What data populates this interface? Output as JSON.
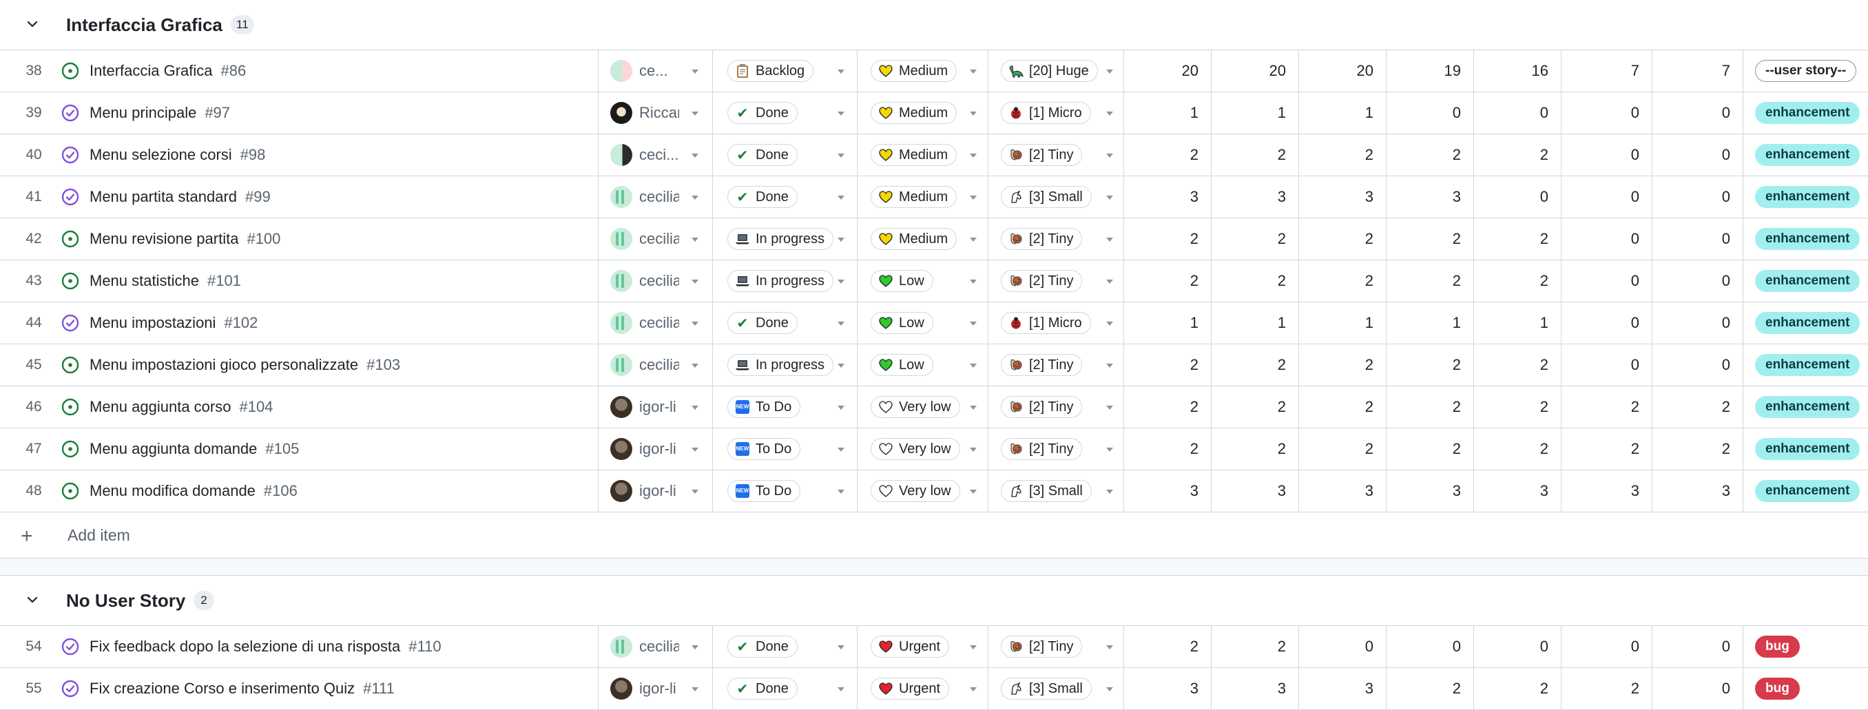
{
  "groups": [
    {
      "title": "Interfaccia Grafica",
      "count": "11",
      "rows": [
        {
          "num": "38",
          "state": "open",
          "title": "Interfaccia Grafica",
          "issue": "#86",
          "avatar": "red",
          "assignee": "ce...",
          "status": {
            "icon": "clipboard-icon",
            "glyph": "📋",
            "label": "Backlog"
          },
          "priority": {
            "icon": "yellow-heart-icon",
            "color": "#f5d800",
            "label": "Medium"
          },
          "size": {
            "icon": "dinosaur-icon",
            "glyph": "🦕",
            "label": "[20] Huge"
          },
          "values": [
            "20",
            "20",
            "20",
            "19",
            "16",
            "7",
            "7"
          ],
          "label": {
            "text": "--user story--",
            "bg": "#ffffff",
            "fg": "#1f2328",
            "border": "#8c959f"
          }
        },
        {
          "num": "39",
          "state": "closed",
          "title": "Menu principale",
          "issue": "#97",
          "avatar": "bw",
          "assignee": "Riccar",
          "status": {
            "icon": "check-icon",
            "glyph": "✔",
            "label": "Done"
          },
          "priority": {
            "icon": "yellow-heart-icon",
            "color": "#f5d800",
            "label": "Medium"
          },
          "size": {
            "icon": "bug-icon",
            "glyph": "🐞",
            "label": "[1] Micro"
          },
          "values": [
            "1",
            "1",
            "1",
            "0",
            "0",
            "0",
            "0"
          ],
          "label": {
            "text": "enhancement",
            "bg": "#a2eeef",
            "fg": "#0b3d3f",
            "border": "#a2eeef"
          }
        },
        {
          "num": "40",
          "state": "closed",
          "title": "Menu selezione corsi",
          "issue": "#98",
          "avatar": "mix",
          "assignee": "ceci...",
          "status": {
            "icon": "check-icon",
            "glyph": "✔",
            "label": "Done"
          },
          "priority": {
            "icon": "yellow-heart-icon",
            "color": "#f5d800",
            "label": "Medium"
          },
          "size": {
            "icon": "snail-icon",
            "glyph": "🐌",
            "label": "[2] Tiny"
          },
          "values": [
            "2",
            "2",
            "2",
            "2",
            "2",
            "0",
            "0"
          ],
          "label": {
            "text": "enhancement",
            "bg": "#a2eeef",
            "fg": "#0b3d3f",
            "border": "#a2eeef"
          }
        },
        {
          "num": "41",
          "state": "closed",
          "title": "Menu partita standard",
          "issue": "#99",
          "avatar": "green",
          "assignee": "cecilia",
          "status": {
            "icon": "check-icon",
            "glyph": "✔",
            "label": "Done"
          },
          "priority": {
            "icon": "yellow-heart-icon",
            "color": "#f5d800",
            "label": "Medium"
          },
          "size": {
            "icon": "unicorn-icon",
            "glyph": "🦄",
            "label": "[3] Small"
          },
          "values": [
            "3",
            "3",
            "3",
            "3",
            "0",
            "0",
            "0"
          ],
          "label": {
            "text": "enhancement",
            "bg": "#a2eeef",
            "fg": "#0b3d3f",
            "border": "#a2eeef"
          }
        },
        {
          "num": "42",
          "state": "open",
          "title": "Menu revisione partita",
          "issue": "#100",
          "avatar": "green",
          "assignee": "cecilia",
          "status": {
            "icon": "laptop-icon",
            "glyph": "💻",
            "label": "In progress"
          },
          "priority": {
            "icon": "yellow-heart-icon",
            "color": "#f5d800",
            "label": "Medium"
          },
          "size": {
            "icon": "snail-icon",
            "glyph": "🐌",
            "label": "[2] Tiny"
          },
          "values": [
            "2",
            "2",
            "2",
            "2",
            "2",
            "0",
            "0"
          ],
          "label": {
            "text": "enhancement",
            "bg": "#a2eeef",
            "fg": "#0b3d3f",
            "border": "#a2eeef"
          }
        },
        {
          "num": "43",
          "state": "open",
          "title": "Menu statistiche",
          "issue": "#101",
          "avatar": "green",
          "assignee": "cecilia",
          "status": {
            "icon": "laptop-icon",
            "glyph": "💻",
            "label": "In progress"
          },
          "priority": {
            "icon": "green-heart-icon",
            "color": "#2ecc2e",
            "label": "Low"
          },
          "size": {
            "icon": "snail-icon",
            "glyph": "🐌",
            "label": "[2] Tiny"
          },
          "values": [
            "2",
            "2",
            "2",
            "2",
            "2",
            "0",
            "0"
          ],
          "label": {
            "text": "enhancement",
            "bg": "#a2eeef",
            "fg": "#0b3d3f",
            "border": "#a2eeef"
          }
        },
        {
          "num": "44",
          "state": "closed",
          "title": "Menu impostazioni",
          "issue": "#102",
          "avatar": "green",
          "assignee": "cecilia",
          "status": {
            "icon": "check-icon",
            "glyph": "✔",
            "label": "Done"
          },
          "priority": {
            "icon": "green-heart-icon",
            "color": "#2ecc2e",
            "label": "Low"
          },
          "size": {
            "icon": "bug-icon",
            "glyph": "🐞",
            "label": "[1] Micro"
          },
          "values": [
            "1",
            "1",
            "1",
            "1",
            "1",
            "0",
            "0"
          ],
          "label": {
            "text": "enhancement",
            "bg": "#a2eeef",
            "fg": "#0b3d3f",
            "border": "#a2eeef"
          }
        },
        {
          "num": "45",
          "state": "open",
          "title": "Menu impostazioni gioco personalizzate",
          "issue": "#103",
          "avatar": "green",
          "assignee": "cecilia",
          "status": {
            "icon": "laptop-icon",
            "glyph": "💻",
            "label": "In progress"
          },
          "priority": {
            "icon": "green-heart-icon",
            "color": "#2ecc2e",
            "label": "Low"
          },
          "size": {
            "icon": "snail-icon",
            "glyph": "🐌",
            "label": "[2] Tiny"
          },
          "values": [
            "2",
            "2",
            "2",
            "2",
            "2",
            "0",
            "0"
          ],
          "label": {
            "text": "enhancement",
            "bg": "#a2eeef",
            "fg": "#0b3d3f",
            "border": "#a2eeef"
          }
        },
        {
          "num": "46",
          "state": "open",
          "title": "Menu aggiunta corso",
          "issue": "#104",
          "avatar": "dark",
          "assignee": "igor-li",
          "status": {
            "icon": "new-icon",
            "glyph": "🆕",
            "label": "To Do"
          },
          "priority": {
            "icon": "white-heart-icon",
            "color": "#ffffff",
            "label": "Very low"
          },
          "size": {
            "icon": "snail-icon",
            "glyph": "🐌",
            "label": "[2] Tiny"
          },
          "values": [
            "2",
            "2",
            "2",
            "2",
            "2",
            "2",
            "2"
          ],
          "label": {
            "text": "enhancement",
            "bg": "#a2eeef",
            "fg": "#0b3d3f",
            "border": "#a2eeef"
          }
        },
        {
          "num": "47",
          "state": "open",
          "title": "Menu aggiunta domande",
          "issue": "#105",
          "avatar": "dark",
          "assignee": "igor-li",
          "status": {
            "icon": "new-icon",
            "glyph": "🆕",
            "label": "To Do"
          },
          "priority": {
            "icon": "white-heart-icon",
            "color": "#ffffff",
            "label": "Very low"
          },
          "size": {
            "icon": "snail-icon",
            "glyph": "🐌",
            "label": "[2] Tiny"
          },
          "values": [
            "2",
            "2",
            "2",
            "2",
            "2",
            "2",
            "2"
          ],
          "label": {
            "text": "enhancement",
            "bg": "#a2eeef",
            "fg": "#0b3d3f",
            "border": "#a2eeef"
          }
        },
        {
          "num": "48",
          "state": "open",
          "title": "Menu modifica domande",
          "issue": "#106",
          "avatar": "dark",
          "assignee": "igor-li",
          "status": {
            "icon": "new-icon",
            "glyph": "🆕",
            "label": "To Do"
          },
          "priority": {
            "icon": "white-heart-icon",
            "color": "#ffffff",
            "label": "Very low"
          },
          "size": {
            "icon": "unicorn-icon",
            "glyph": "🦄",
            "label": "[3] Small"
          },
          "values": [
            "3",
            "3",
            "3",
            "3",
            "3",
            "3",
            "3"
          ],
          "label": {
            "text": "enhancement",
            "bg": "#a2eeef",
            "fg": "#0b3d3f",
            "border": "#a2eeef"
          }
        }
      ],
      "add_item": "Add item"
    },
    {
      "title": "No User Story",
      "count": "2",
      "rows": [
        {
          "num": "54",
          "state": "closed",
          "title": "Fix feedback dopo la selezione di una risposta",
          "issue": "#110",
          "avatar": "green",
          "assignee": "cecilia",
          "status": {
            "icon": "check-icon",
            "glyph": "✔",
            "label": "Done"
          },
          "priority": {
            "icon": "red-heart-icon",
            "color": "#e5232e",
            "label": "Urgent"
          },
          "size": {
            "icon": "snail-icon",
            "glyph": "🐌",
            "label": "[2] Tiny"
          },
          "values": [
            "2",
            "2",
            "0",
            "0",
            "0",
            "0",
            "0"
          ],
          "label": {
            "text": "bug",
            "bg": "#d73a4a",
            "fg": "#ffffff",
            "border": "#d73a4a"
          }
        },
        {
          "num": "55",
          "state": "closed",
          "title": "Fix creazione Corso e inserimento Quiz",
          "issue": "#111",
          "avatar": "dark",
          "assignee": "igor-li",
          "status": {
            "icon": "check-icon",
            "glyph": "✔",
            "label": "Done"
          },
          "priority": {
            "icon": "red-heart-icon",
            "color": "#e5232e",
            "label": "Urgent"
          },
          "size": {
            "icon": "unicorn-icon",
            "glyph": "🦄",
            "label": "[3] Small"
          },
          "values": [
            "3",
            "3",
            "3",
            "2",
            "2",
            "2",
            "0"
          ],
          "label": {
            "text": "bug",
            "bg": "#d73a4a",
            "fg": "#ffffff",
            "border": "#d73a4a"
          }
        }
      ]
    }
  ],
  "colors": {
    "open_state": "#1a7f37",
    "closed_state": "#8250df",
    "border": "#d0d7de",
    "muted_text": "#59636e"
  }
}
